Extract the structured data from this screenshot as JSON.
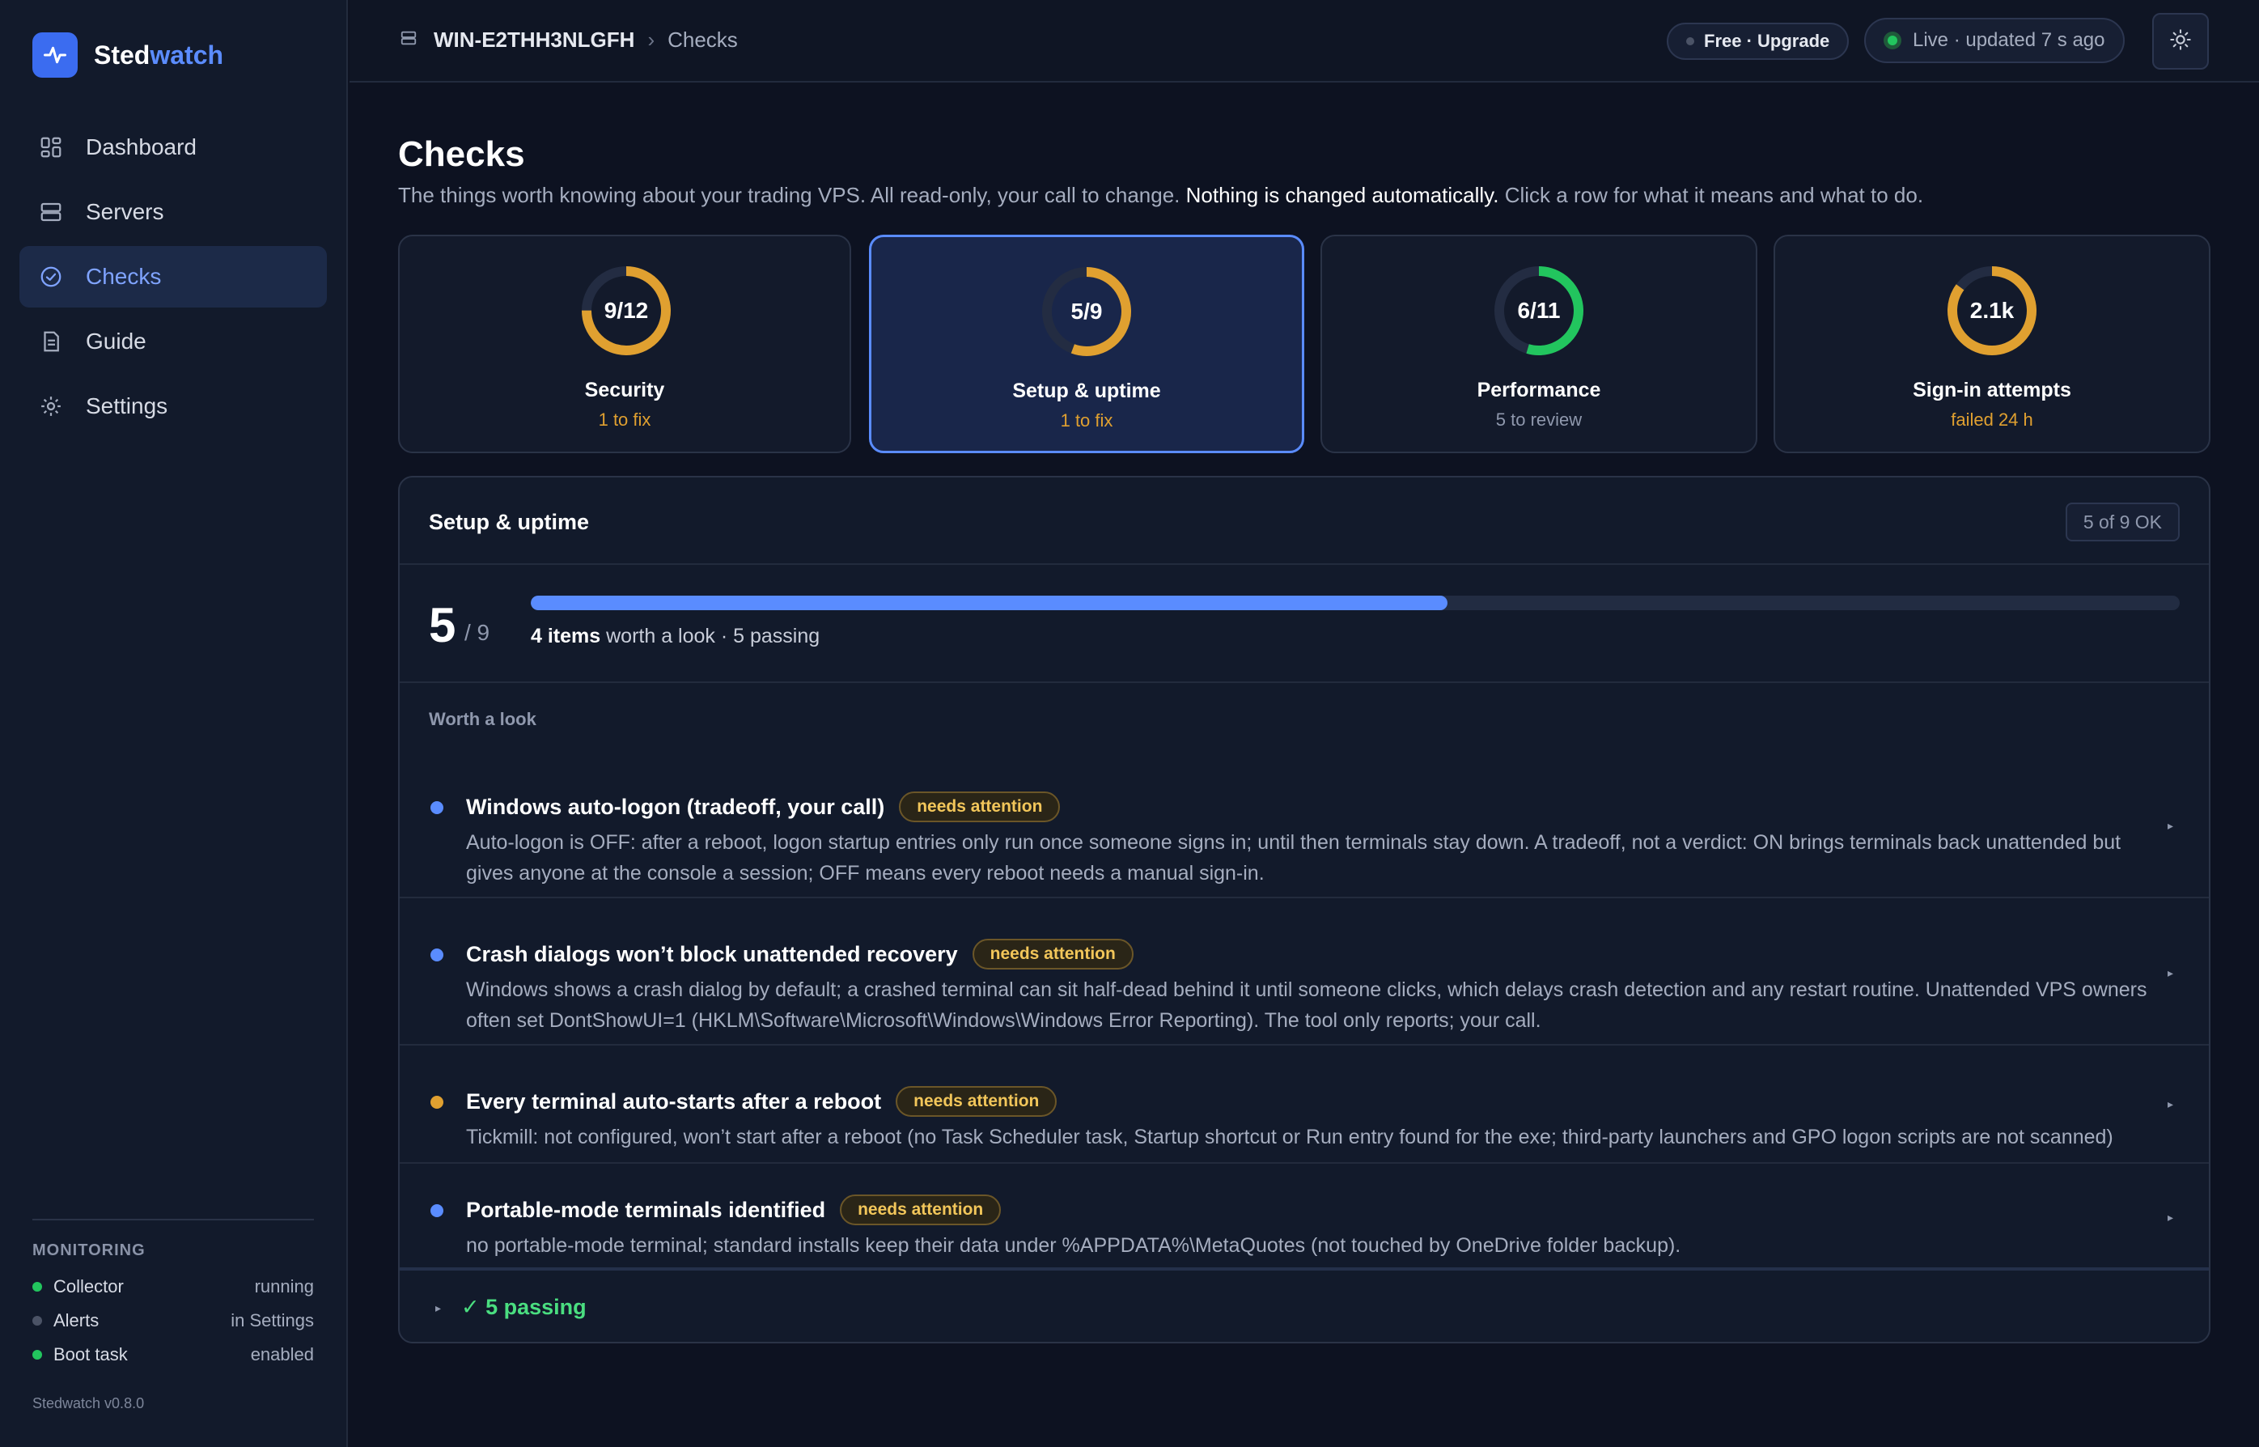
{
  "brand": {
    "name_part1": "Sted",
    "name_part2": "watch"
  },
  "nav": [
    {
      "label": "Dashboard",
      "icon": "dashboard-icon"
    },
    {
      "label": "Servers",
      "icon": "server-icon"
    },
    {
      "label": "Checks",
      "icon": "check-circle-icon",
      "active": true
    },
    {
      "label": "Guide",
      "icon": "document-icon"
    },
    {
      "label": "Settings",
      "icon": "gear-icon"
    }
  ],
  "monitoring": {
    "title": "MONITORING",
    "rows": [
      {
        "label": "Collector",
        "value": "running",
        "color": "#22c55e"
      },
      {
        "label": "Alerts",
        "value": "in Settings",
        "color": "#4b5366"
      },
      {
        "label": "Boot task",
        "value": "enabled",
        "color": "#22c55e"
      }
    ]
  },
  "version": "Stedwatch v0.8.0",
  "topbar": {
    "host": "WIN-E2THH3NLGFH",
    "separator": "›",
    "page": "Checks",
    "plan_label": "Free · Upgrade",
    "live_label": "Live · updated 7 s ago"
  },
  "header": {
    "title": "Checks",
    "subtitle_a": "The things worth knowing about your trading VPS. All read-only, your call to change. ",
    "subtitle_em": "Nothing is changed automatically.",
    "subtitle_b": " Click a row for what it means and what to do."
  },
  "cards": [
    {
      "value": "9/12",
      "name": "Security",
      "sub": "1 to fix",
      "fraction": 0.75,
      "ring_color": "#e0a030",
      "sub_color": "#e0a030"
    },
    {
      "value": "5/9",
      "name": "Setup & uptime",
      "sub": "1 to fix",
      "fraction": 0.556,
      "ring_color": "#e0a030",
      "sub_color": "#e0a030",
      "selected": true
    },
    {
      "value": "6/11",
      "name": "Performance",
      "sub": "5 to review",
      "fraction": 0.545,
      "ring_color": "#22c55e",
      "sub_color": "#8f98ad"
    },
    {
      "value": "2.1k",
      "name": "Sign-in attempts",
      "sub": "failed 24 h",
      "fraction": 0.85,
      "ring_color": "#e0a030",
      "sub_color": "#e0a030"
    }
  ],
  "panel": {
    "title": "Setup & uptime",
    "ok_badge": "5 of 9 OK",
    "score": "5",
    "score_of": "/ 9",
    "progress_fraction": 0.556,
    "summary_bold": "4 items",
    "summary_rest": " worth a look · 5 passing",
    "section_label": "Worth a look",
    "items": [
      {
        "title": "Windows auto-logon (tradeoff, your call)",
        "tag": "needs attention",
        "dot_color": "#5a8cff",
        "desc": "Auto-logon is OFF: after a reboot, logon startup entries only run once someone signs in; until then terminals stay down. A tradeoff, not a verdict: ON brings terminals back unattended but gives anyone at the console a session; OFF means every reboot needs a manual sign-in."
      },
      {
        "title": "Crash dialogs won’t block unattended recovery",
        "tag": "needs attention",
        "dot_color": "#5a8cff",
        "desc": "Windows shows a crash dialog by default; a crashed terminal can sit half-dead behind it until someone clicks, which delays crash detection and any restart routine. Unattended VPS owners often set DontShowUI=1 (HKLM\\Software\\Microsoft\\Windows\\Windows Error Reporting). The tool only reports; your call."
      },
      {
        "title": "Every terminal auto-starts after a reboot",
        "tag": "needs attention",
        "dot_color": "#e0a030",
        "desc": "Tickmill: not configured, won’t start after a reboot (no Task Scheduler task, Startup shortcut or Run entry found for the exe; third-party launchers and GPO logon scripts are not scanned)"
      },
      {
        "title": "Portable-mode terminals identified",
        "tag": "needs attention",
        "dot_color": "#5a8cff",
        "desc": "no portable-mode terminal; standard installs keep their data under %APPDATA%\\MetaQuotes (not touched by OneDrive folder backup)."
      }
    ],
    "passing_label": "✓ 5 passing"
  }
}
